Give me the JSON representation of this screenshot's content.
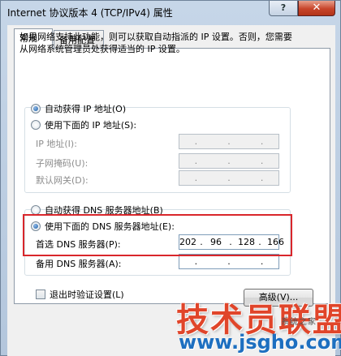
{
  "window": {
    "title": "Internet 协议版本 4 (TCP/IPv4) 属性",
    "help_label": "?",
    "close_label": "✕"
  },
  "tabs": [
    {
      "label": "常规",
      "active": true
    },
    {
      "label": "备用配置",
      "active": false
    }
  ],
  "description": "如果网络支持此功能，则可以获取自动指派的 IP 设置。否则，您需要从网络系统管理员处获得适当的 IP 设置。",
  "ip_section": {
    "auto_label": "自动获得 IP 地址(O)",
    "manual_label": "使用下面的 IP 地址(S):",
    "fields": [
      {
        "label": "IP 地址(I):",
        "value": [
          ".",
          ".",
          "."
        ]
      },
      {
        "label": "子网掩码(U):",
        "value": [
          ".",
          ".",
          "."
        ]
      },
      {
        "label": "默认网关(D):",
        "value": [
          ".",
          ".",
          "."
        ]
      }
    ]
  },
  "dns_section": {
    "auto_label": "自动获得 DNS 服务器地址(B)",
    "manual_label": "使用下面的 DNS 服务器地址(E):",
    "preferred_label": "首选 DNS 服务器(P):",
    "preferred_value": [
      "202",
      ".",
      "96",
      ".",
      "128",
      ".",
      "166"
    ],
    "alternate_label": "备用 DNS 服务器(A):",
    "alternate_value": [
      ".",
      ".",
      "."
    ]
  },
  "validate_label": "退出时验证设置(L)",
  "advanced_label": "高级(V)...",
  "watermark": {
    "cn": "技术员联盟",
    "url": "www.jsgho.com",
    "cap": "系统之家"
  },
  "colors": {
    "highlight": "#d9262b",
    "watermark_red": "#e0452a",
    "watermark_blue": "#1d6fc0"
  }
}
